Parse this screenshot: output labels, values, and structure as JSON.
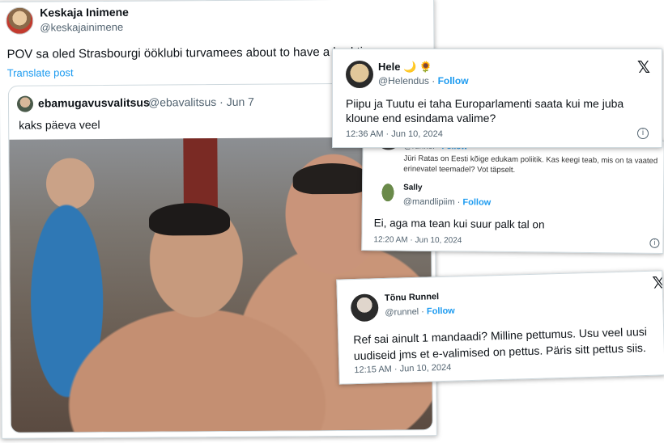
{
  "main_post": {
    "author_name": "Keskaja Inimene",
    "author_handle": "@keskajainimene",
    "text": "POV sa oled Strasbourgi ööklubi turvamees about to have a bad time",
    "translate": "Translate post",
    "quote": {
      "author_name": "ebamugavusvalitsus",
      "author_handle": "@ebavalitsus · Jun 7",
      "text": "kaks päeva veel"
    }
  },
  "hele_post": {
    "author_name": "Hele 🌙 🌻",
    "author_handle": "@Helendus ·",
    "follow": "Follow",
    "text": "Piipu ja Tuutu ei taha Europarlamenti saata kui me juba kloune end esindama valime?",
    "time": "12:36 AM · Jun 10, 2024",
    "close": "𝕏",
    "info": "i"
  },
  "sally_post": {
    "prev_handle": "@runnel · ",
    "prev_follow": "Follow",
    "prev_text": "Jüri Ratas on Eesti kõige edukam poliitik. Kas keegi teab, mis on ta vaated erinevatel teemadel? Vot täpselt.",
    "author_name": "Sally",
    "author_handle": "@mandlipiim ·",
    "follow": "Follow",
    "text": "Ei, aga ma tean kui suur palk tal on",
    "time": "12:20 AM · Jun 10, 2024",
    "info": "i"
  },
  "tonu_post": {
    "author_name": "Tõnu Runnel",
    "author_handle": "@runnel ·",
    "follow": "Follow",
    "text": "Ref sai ainult 1 mandaadi? Milline pettumus. Usu veel uusi uudiseid jms et e-valimised on pettus. Päris sitt pettus siis.",
    "time": "12:15 AM · Jun 10, 2024",
    "close": "𝕏"
  }
}
